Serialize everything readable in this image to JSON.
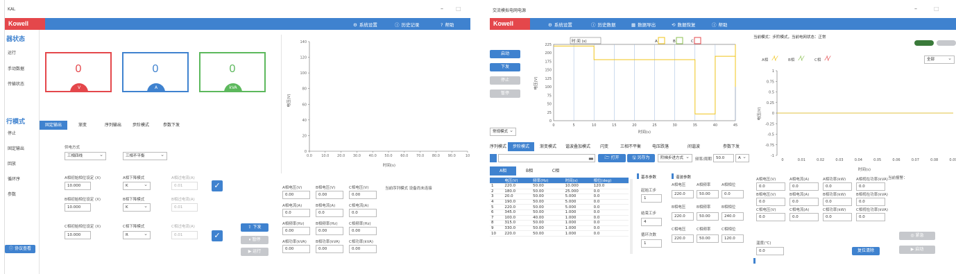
{
  "left": {
    "title": "KAL",
    "brand": "Kowell",
    "menu": [
      {
        "icon": "⚙",
        "label": "系统设置"
      },
      {
        "icon": "ⓘ",
        "label": "历史记录"
      },
      {
        "icon": "?",
        "label": "帮助"
      }
    ],
    "status_title": "器状态",
    "status_items": [
      "运行",
      "手动数据",
      "传输状态"
    ],
    "mode_title": "行模式",
    "mode_items": [
      "停止",
      "固定输出",
      "回放",
      "循环序",
      "参数"
    ],
    "bottom_button": "ⓘ 协议查看",
    "gauges": [
      {
        "value": "0",
        "unit": "V",
        "color": "#e4474b"
      },
      {
        "value": "0",
        "unit": "A",
        "color": "#3f82cf"
      },
      {
        "value": "0",
        "unit": "kVA",
        "color": "#5cb85c"
      }
    ],
    "tabs": [
      "固定输出",
      "渐变",
      "序列输出",
      "步阶模式",
      "参数下发"
    ],
    "params": {
      "wiring_label": "供电方式",
      "wiring_value": "三相四线",
      "balance_value": "三相不平衡",
      "rows": [
        {
          "phase_label": "A相初始相位设定 (X)",
          "value": "10.000",
          "mode_label": "A相下降模式",
          "mode": "K",
          "rate_label": "A相过电流(A)",
          "rate": "0.01"
        },
        {
          "phase_label": "B相初始相位设定 (X)",
          "value": "10.000",
          "mode_label": "B相下降模式",
          "mode": "K",
          "rate_label": "B相过电流(A)",
          "rate": "0.01"
        },
        {
          "phase_label": "C相初始相位设定 (X)",
          "value": "10.000",
          "mode_label": "C相下降模式",
          "mode": "R",
          "rate_label": "C相过电流(A)",
          "rate": "0.01"
        }
      ]
    },
    "side_buttons": [
      "下发",
      "暂停",
      "运行"
    ],
    "chart": {
      "ylabel": "电压(V)",
      "xlabel": "时间(s)",
      "yticks": [
        "140",
        "120",
        "100",
        "80",
        "60",
        "40",
        "20",
        "0"
      ],
      "xticks": [
        "0.0",
        "10.0",
        "20.0",
        "30.0",
        "40.0",
        "50.0",
        "60.0",
        "70.0",
        "80.0",
        "90.0",
        "10"
      ]
    },
    "readings": [
      {
        "label": "A相电压(V)",
        "value": "0.00"
      },
      {
        "label": "B相电压(V)",
        "value": "0.00"
      },
      {
        "label": "C相电压(V)",
        "value": "0.00"
      },
      {
        "label": "A相电流(A)",
        "value": "0.0"
      },
      {
        "label": "B相电流(A)",
        "value": "0.0"
      },
      {
        "label": "C相电流(A)",
        "value": "0.0"
      },
      {
        "label": "A相频率(Hz)",
        "value": "0.00"
      },
      {
        "label": "B相频率(Hz)",
        "value": "0.00"
      },
      {
        "label": "C相频率(Hz)",
        "value": "0.00"
      },
      {
        "label": "A相功率(kVA)",
        "value": "0.00"
      },
      {
        "label": "B相功率(kVA)",
        "value": "0.00"
      },
      {
        "label": "C相功率(kVA)",
        "value": "0.00"
      }
    ],
    "note": "当前序列模式 设备尚未连接"
  },
  "right": {
    "title": "交流模拟电网电源",
    "brand": "Kowell",
    "menu": [
      {
        "icon": "⚙",
        "label": "系统设置"
      },
      {
        "icon": "ⓘ",
        "label": "历史数据"
      },
      {
        "icon": "▦",
        "label": "数据导出"
      },
      {
        "icon": "⟲",
        "label": "数据恢复"
      },
      {
        "icon": "ⓘ",
        "label": "帮助"
      }
    ],
    "nav_buttons": [
      "启动",
      "下发",
      "停止",
      "暂停"
    ],
    "mode_select": "常规模式",
    "step_chart": {
      "ylabel": "电压(V)",
      "xlabel": "时间(s)",
      "top_label": "时 间 (s)",
      "legend": [
        "A",
        "B",
        "C"
      ],
      "legend_colors": [
        "#f0c419",
        "#8cc152",
        "#e4474b"
      ],
      "yticks": [
        "225",
        "200",
        "175",
        "150",
        "125",
        "100",
        "75",
        "50",
        "25",
        "0"
      ],
      "xticks": [
        "0",
        "5",
        "10",
        "15",
        "20",
        "25",
        "30",
        "35",
        "40",
        "45"
      ]
    },
    "tabs": [
      "序列模式",
      "步阶模式",
      "渐变模式",
      "谐波叠加模式",
      "闪变",
      "三相不平衡",
      "电压跌落",
      "间谐波",
      "参数下发"
    ],
    "toolbar": {
      "open": "打开",
      "save": "另存为",
      "step_mode": "阶梯步进方式",
      "period_label": "频率/周期",
      "period_value": "50.0",
      "unit": "A"
    },
    "phase_tabs": [
      "A相",
      "B相",
      "C相"
    ],
    "table": {
      "headers": [
        "",
        "电压(V)",
        "频率(Hz)",
        "时间(s)",
        "相位(deg)"
      ],
      "rows": [
        [
          "1",
          "220.0",
          "50.00",
          "10.000",
          "120.0"
        ],
        [
          "2",
          "180.0",
          "50.00",
          "25.000",
          "0.0"
        ],
        [
          "3",
          "20.0",
          "50.00",
          "5.000",
          "0.0"
        ],
        [
          "4",
          "190.0",
          "50.00",
          "5.000",
          "0.0"
        ],
        [
          "5",
          "220.0",
          "50.00",
          "5.000",
          "0.0"
        ],
        [
          "6",
          "345.0",
          "50.00",
          "1.000",
          "0.0"
        ],
        [
          "7",
          "100.0",
          "40.00",
          "1.000",
          "0.0"
        ],
        [
          "8",
          "315.0",
          "50.00",
          "1.000",
          "0.0"
        ],
        [
          "9",
          "330.0",
          "50.00",
          "1.000",
          "0.0"
        ],
        [
          "10",
          "220.0",
          "50.00",
          "1.000",
          "0.0"
        ]
      ]
    },
    "basic": {
      "title_a": "基本参数",
      "title_b": "谐波参数",
      "repeat_label": "起始工步",
      "repeat_value": "1",
      "end_label": "结束工步",
      "end_value": "4",
      "cycles_label": "循环次数",
      "cycles_value": "1",
      "cols": [
        "A相电压",
        "A相频率",
        "A相相位"
      ],
      "cols_b": [
        "B相电压",
        "B相频率",
        "B相相位"
      ],
      "cols_c": [
        "C相电压",
        "C相频率",
        "C相相位"
      ],
      "vals_a": [
        "220.0",
        "50.00",
        "0.0"
      ],
      "vals_b": [
        "220.0",
        "50.00",
        "240.0"
      ],
      "vals_c": [
        "220.0",
        "50.00",
        "120.0"
      ]
    },
    "status_text": "当前模式：步阶模式，当前电网状态：正常",
    "wave_legend": [
      "A相",
      "B相",
      "C相"
    ],
    "wave_legend_colors": [
      "#f0c419",
      "#8cc152",
      "#e4474b"
    ],
    "wave_select": "全部",
    "wave_chart": {
      "ylabel": "电压(V)",
      "xlabel": "时间(s)",
      "yticks": [
        "1",
        "0.75",
        "0.5",
        "0.25",
        "0",
        "-0.25",
        "-0.5",
        "-0.75",
        "-1"
      ],
      "xticks": [
        "0",
        "0.01",
        "0.02",
        "0.03",
        "0.04",
        "0.05",
        "0.06",
        "0.07",
        "0.08",
        "0.09"
      ]
    },
    "readings": [
      {
        "label": "A相电压(V)",
        "value": "0.0"
      },
      {
        "label": "A相电流(A)",
        "value": "0.0"
      },
      {
        "label": "A相功率(kW)",
        "value": "0.0"
      },
      {
        "label": "A相视在功率(kVA)",
        "value": "0.0"
      },
      {
        "label": "B相电压(V)",
        "value": "0.0"
      },
      {
        "label": "B相电流(A)",
        "value": "0.0"
      },
      {
        "label": "B相功率(kW)",
        "value": "0.0"
      },
      {
        "label": "B相视在功率(kVA)",
        "value": "0.0"
      },
      {
        "label": "C相电压(V)",
        "value": "0.0"
      },
      {
        "label": "C相电流(A)",
        "value": "0.0"
      },
      {
        "label": "C相功率(kW)",
        "value": "0.0"
      },
      {
        "label": "C相视在功率(kVA)",
        "value": "0.0"
      }
    ],
    "temp_label": "温度(℃)",
    "temp_value": "0.0",
    "alarm_label": "当前报警：",
    "reset_btn": "复位清除",
    "stop_btn": "◎ 紧急",
    "run_btn": "▶ 启动"
  }
}
